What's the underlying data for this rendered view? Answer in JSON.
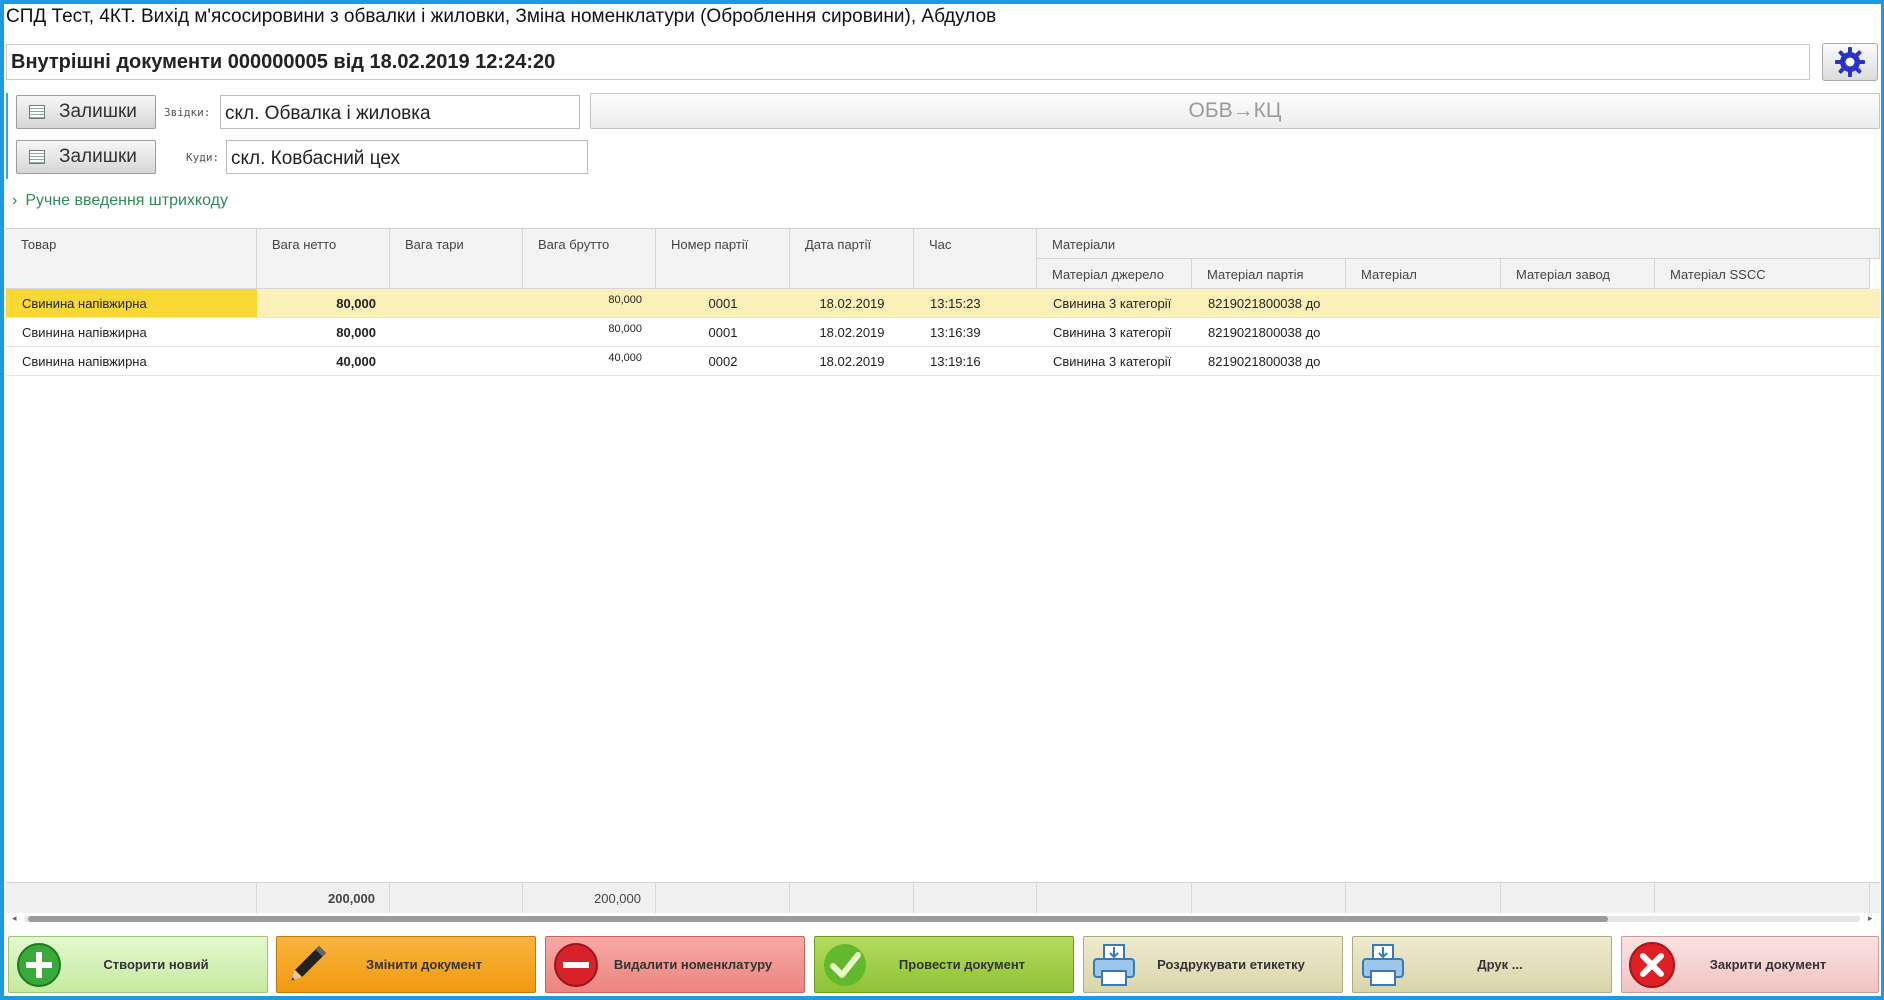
{
  "window": {
    "title": "СПД Тест, 4КТ. Вихід м'ясосировини з обвалки і жиловки, Зміна номенклатури (Оброблення сировини), Абдулов"
  },
  "document": {
    "title": "Внутрішні документи 000000005 від 18.02.2019 12:24:20"
  },
  "from": {
    "button_label": "Залишки",
    "label": "Звідки:",
    "value": "скл. Обвалка і жиловка"
  },
  "to": {
    "button_label": "Залишки",
    "label": "Куди:",
    "value": "скл. Ковбасний цех"
  },
  "route": {
    "label": "ОБВ→КЦ"
  },
  "barcode": {
    "label": "Ручне введення штрихкоду"
  },
  "table": {
    "headers": [
      "Товар",
      "Вага нетто",
      "Вага тари",
      "Вага брутто",
      "Номер партії",
      "Дата партії",
      "Час",
      "Матеріали"
    ],
    "sub_headers": [
      "Матеріал джерело",
      "Матеріал партія",
      "Матеріал",
      "Матеріал завод",
      "Матеріал SSCC"
    ],
    "rows": [
      [
        "Свинина напівжирна",
        "80,000",
        "",
        "80,000",
        "0001",
        "18.02.2019",
        "13:15:23",
        "Свинина 3 категорії",
        "8219021800038 до",
        "",
        "",
        ""
      ],
      [
        "Свинина напівжирна",
        "80,000",
        "",
        "80,000",
        "0001",
        "18.02.2019",
        "13:16:39",
        "Свинина 3 категорії",
        "8219021800038 до",
        "",
        "",
        ""
      ],
      [
        "Свинина напівжирна",
        "40,000",
        "",
        "40,000",
        "0002",
        "18.02.2019",
        "13:19:16",
        "Свинина 3 категорії",
        "8219021800038 до",
        "",
        "",
        ""
      ]
    ],
    "totals": {
      "net": "200,000",
      "gross": "200,000"
    },
    "selected_row": 0
  },
  "actions": [
    {
      "label": "Створити новий",
      "icon": "plus-icon",
      "color": "#d2f0b4"
    },
    {
      "label": "Змінити документ",
      "icon": "pencil-icon",
      "color": "#f7a21b"
    },
    {
      "label": "Видалити номенклатуру",
      "icon": "minus-icon",
      "color": "#f0908c"
    },
    {
      "label": "Провести документ",
      "icon": "checkmark-icon",
      "color": "#9ccc3c"
    },
    {
      "label": "Роздрукувати етикетку",
      "icon": "printer-icon",
      "color": "#e7e3c2"
    },
    {
      "label": "Друк ...",
      "icon": "printer-icon",
      "color": "#e7e3c2"
    },
    {
      "label": "Закрити документ",
      "icon": "close-icon",
      "color": "#f5cdcd"
    }
  ]
}
